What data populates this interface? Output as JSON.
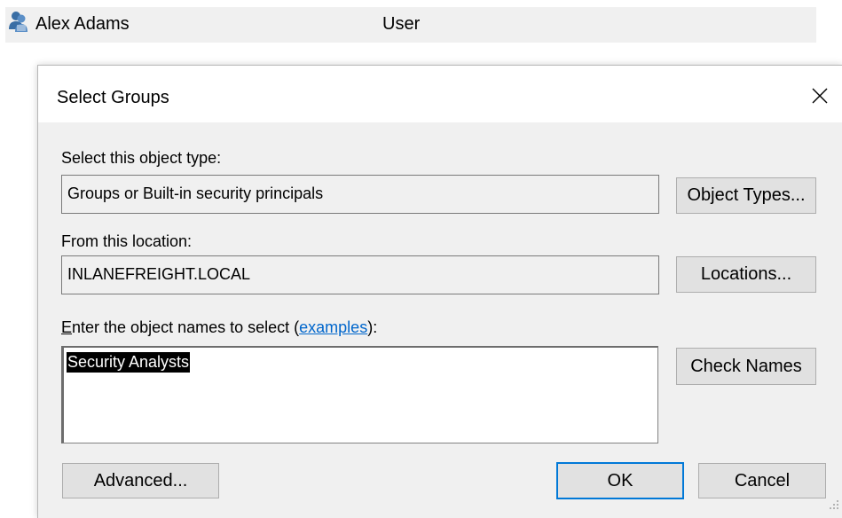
{
  "background_row": {
    "name": "Alex Adams",
    "type": "User",
    "icon": "user-icon"
  },
  "dialog": {
    "title": "Select Groups",
    "close_icon": "close-icon",
    "object_type": {
      "label": "Select this object type:",
      "value": "Groups or Built-in security principals",
      "button": "Object Types..."
    },
    "location": {
      "label": "From this location:",
      "value": "INLANEFREIGHT.LOCAL",
      "button": "Locations..."
    },
    "names": {
      "label_accel": "E",
      "label_before": "nter the object names to select (",
      "link": "examples",
      "label_after": "):",
      "value": "Security Analysts",
      "check_button": "Check Names"
    },
    "buttons": {
      "advanced": "Advanced...",
      "ok": "OK",
      "cancel": "Cancel"
    },
    "colors": {
      "dialog_bg": "#f0f0f0",
      "default_button_border": "#0078d7",
      "link": "#0066cc"
    }
  }
}
